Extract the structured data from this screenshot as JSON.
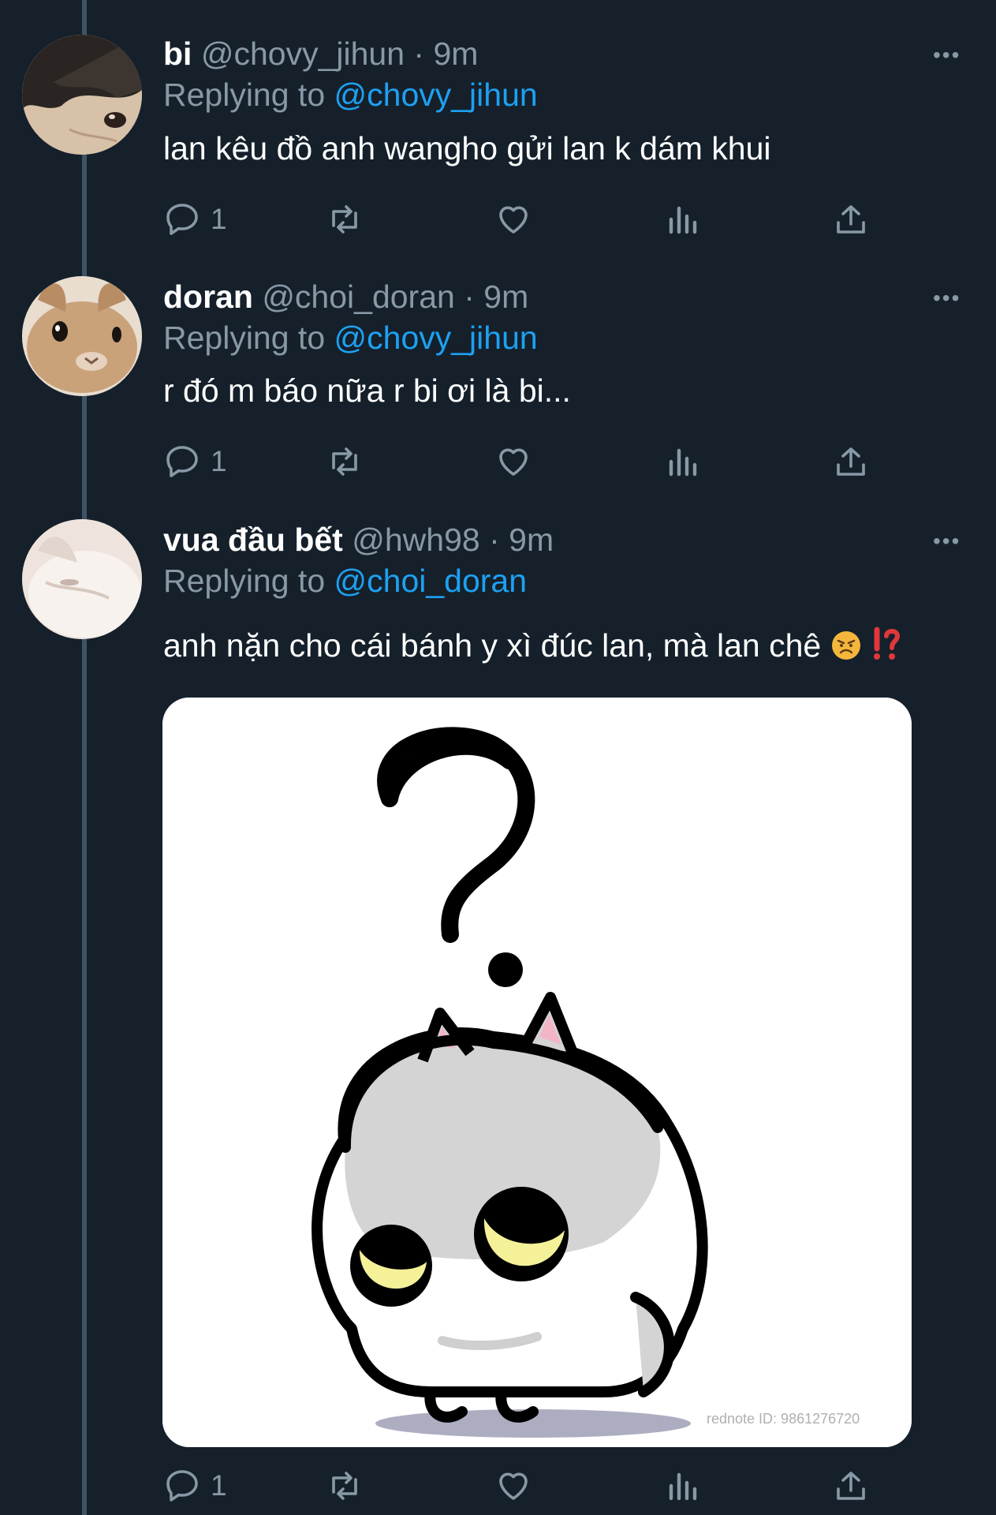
{
  "colors": {
    "background": "#15202b",
    "text": "#ffffff",
    "muted": "#8899a6",
    "link": "#1da1f2",
    "thread_line": "#3d5466"
  },
  "tweets": [
    {
      "name": "bi",
      "handle": "@chovy_jihun",
      "time": "· 9m",
      "replying_label": "Replying to",
      "replying_to": "@chovy_jihun",
      "text": "lan kêu đồ anh wangho gửi lan k dám khui",
      "reply_count": "1",
      "more": "•••"
    },
    {
      "name": "doran",
      "handle": "@choi_doran",
      "time": "· 9m",
      "replying_label": "Replying to",
      "replying_to": "@chovy_jihun",
      "text": "r đó m báo nữa r bi ơi là bi...",
      "reply_count": "1",
      "more": "•••"
    },
    {
      "name": "vua đầu bết",
      "handle": "@hwh98",
      "time": "· 9m",
      "replying_label": "Replying to",
      "replying_to": "@choi_doran",
      "text": "anh nặn cho cái bánh y xì đúc lan, mà lan chê",
      "emoji": [
        "angry-face-emoji",
        "interrobang-emoji"
      ],
      "reply_count": "1",
      "more": "•••",
      "media": {
        "watermark": "rednote ID: 9861276720",
        "content": "cartoon-cat-question-mark"
      }
    }
  ],
  "icons": [
    "reply-icon",
    "retweet-icon",
    "like-icon",
    "analytics-icon",
    "share-icon"
  ]
}
